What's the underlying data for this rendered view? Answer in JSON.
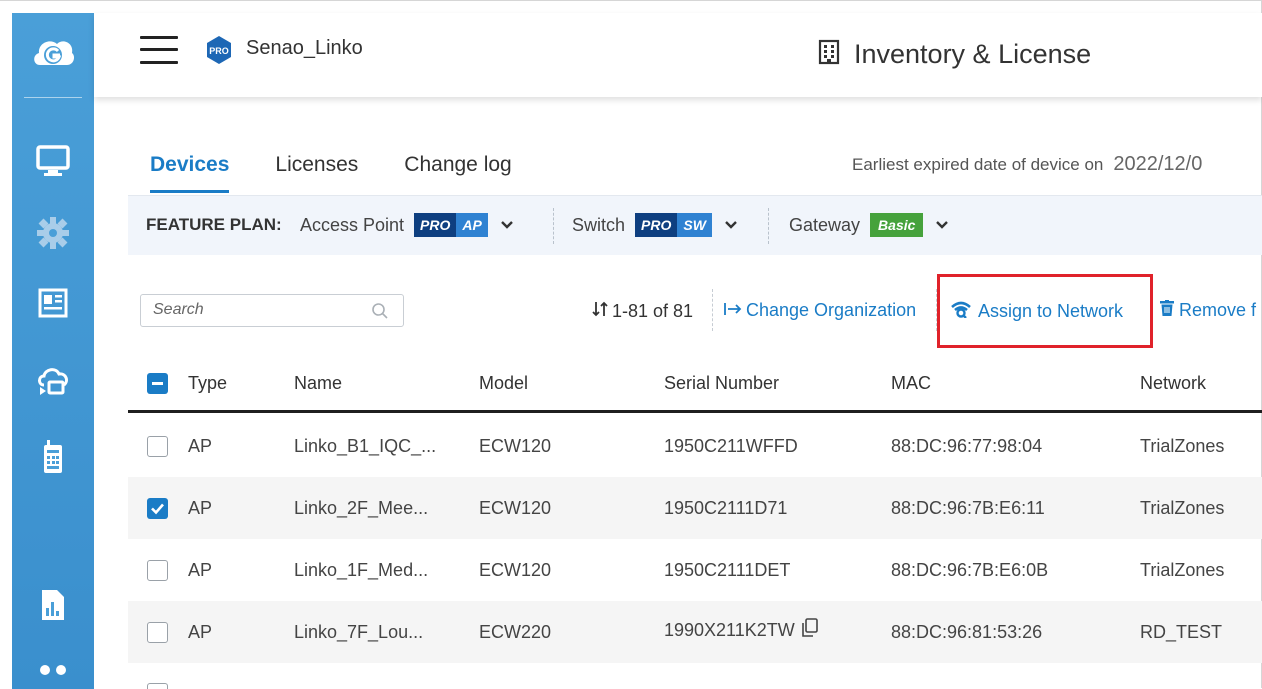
{
  "header": {
    "org_badge": "PRO",
    "org_name": "Senao_Linko",
    "page_title": "Inventory & License"
  },
  "tabs": [
    {
      "label": "Devices",
      "active": true
    },
    {
      "label": "Licenses",
      "active": false
    },
    {
      "label": "Change log",
      "active": false
    }
  ],
  "expire": {
    "label": "Earliest expired date of device on",
    "date": "2022/12/0"
  },
  "feature_plan": {
    "label": "FEATURE PLAN:",
    "items": [
      {
        "name": "Access Point",
        "badge_pro": "PRO",
        "badge_kind": "AP"
      },
      {
        "name": "Switch",
        "badge_pro": "PRO",
        "badge_kind": "SW"
      },
      {
        "name": "Gateway",
        "badge_basic": "Basic"
      }
    ]
  },
  "toolbar": {
    "search_placeholder": "Search",
    "count": "1-81 of 81",
    "change_org": "Change Organization",
    "assign_network": "Assign to Network",
    "remove": "Remove f"
  },
  "table": {
    "columns": [
      "Type",
      "Name",
      "Model",
      "Serial Number",
      "MAC",
      "Network"
    ],
    "rows": [
      {
        "checked": false,
        "type": "AP",
        "name": "Linko_B1_IQC_...",
        "model": "ECW120",
        "serial": "1950C211WFFD",
        "mac": "88:DC:96:77:98:04",
        "network": "TrialZones"
      },
      {
        "checked": true,
        "type": "AP",
        "name": "Linko_2F_Mee...",
        "model": "ECW120",
        "serial": "1950C2111D71",
        "mac": "88:DC:96:7B:E6:11",
        "network": "TrialZones"
      },
      {
        "checked": false,
        "type": "AP",
        "name": "Linko_1F_Med...",
        "model": "ECW120",
        "serial": "1950C2111DET",
        "mac": "88:DC:96:7B:E6:0B",
        "network": "TrialZones"
      },
      {
        "checked": false,
        "type": "AP",
        "name": "Linko_7F_Lou...",
        "model": "ECW220",
        "serial": "1990X211K2TW",
        "mac": "88:DC:96:81:53:26",
        "network": "RD_TEST"
      }
    ]
  },
  "colors": {
    "accent": "#1a7cc6",
    "sidebar": "#4a9fd8",
    "highlight": "#e0222a",
    "pro_dark": "#0e3f80",
    "basic_green": "#46a23c"
  }
}
